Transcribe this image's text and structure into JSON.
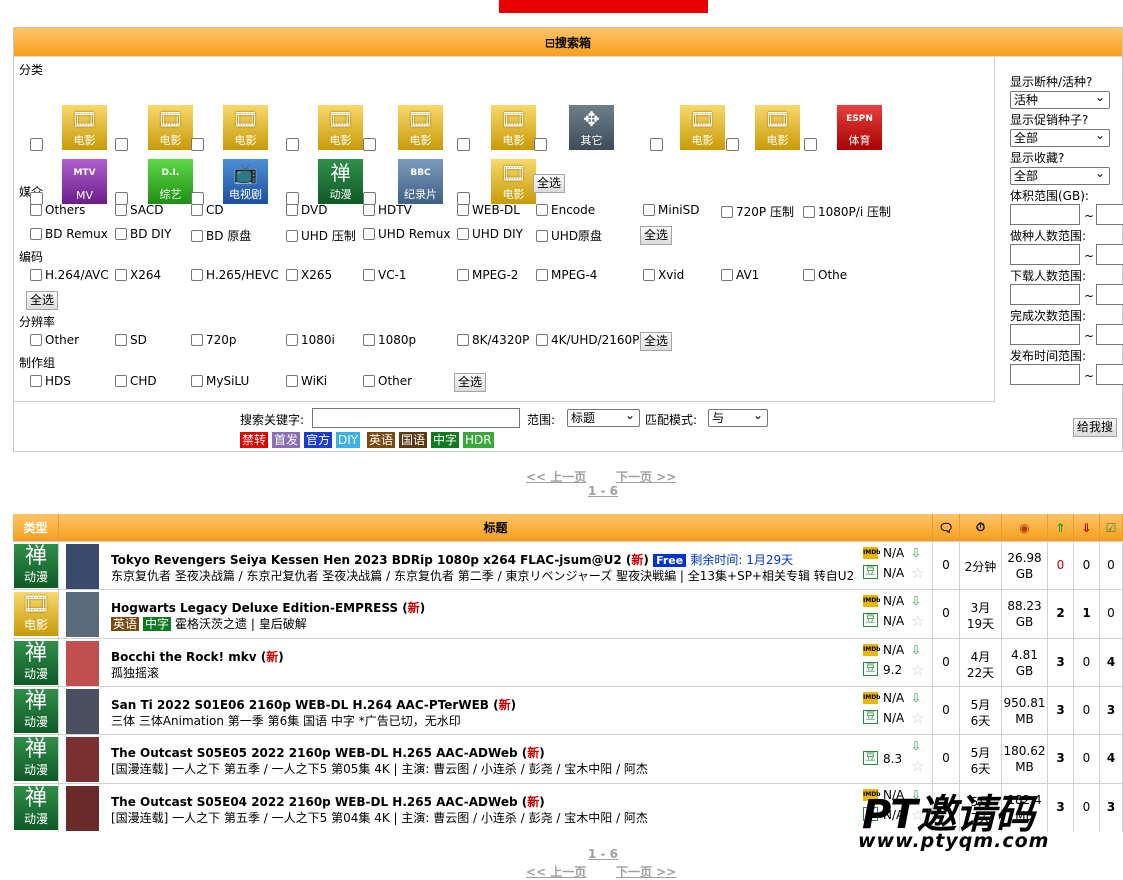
{
  "search_box": {
    "title": "⊟搜索箱",
    "section_category": "分类",
    "section_media": "媒介",
    "section_codec": "编码",
    "section_resolution": "分辨率",
    "section_group": "制作组",
    "select_all": "全选",
    "categories": [
      "电影",
      "电影",
      "电影",
      "电影",
      "电影",
      "电影",
      "其它",
      "电影",
      "电影",
      "体育",
      "MV",
      "综艺",
      "电视剧",
      "动漫",
      "纪录片",
      "电影"
    ],
    "category_glyphs": {
      "movie": "🎞",
      "other": "✥",
      "sport": "ESPN",
      "mv": "MTV",
      "variety": "D.I.",
      "tv": "📺",
      "anime": "禅",
      "doc": "BBC"
    },
    "media": [
      "Others",
      "SACD",
      "CD",
      "DVD",
      "HDTV",
      "WEB-DL",
      "Encode",
      "MiniSD",
      "720P 压制",
      "1080P/i 压制",
      "BD Remux",
      "BD DIY",
      "BD 原盘",
      "UHD 压制",
      "UHD Remux",
      "UHD DIY",
      "UHD原盘"
    ],
    "codec": [
      "H.264/AVC",
      "X264",
      "H.265/HEVC",
      "X265",
      "VC-1",
      "MPEG-2",
      "MPEG-4",
      "Xvid",
      "AV1",
      "Othe"
    ],
    "resolution": [
      "Other",
      "SD",
      "720p",
      "1080i",
      "1080p",
      "8K/4320P",
      "4K/UHD/2160P"
    ],
    "group": [
      "HDS",
      "CHD",
      "MySiLU",
      "WiKi",
      "Other"
    ],
    "keyword_label": "搜索关键字:",
    "keyword_value": "",
    "scope_label": "范围:",
    "scope_value": "标题",
    "match_label": "匹配模式:",
    "match_value": "与",
    "tags": [
      {
        "text": "禁转",
        "color": "#e00000"
      },
      {
        "text": "首发",
        "color": "#8a6fb8"
      },
      {
        "text": "官方",
        "color": "#1a3ccf"
      },
      {
        "text": "DIY",
        "color": "#3ab0e8"
      },
      {
        "text": "英语",
        "color": "#7a4a10"
      },
      {
        "text": "国语",
        "color": "#5a3a10"
      },
      {
        "text": "中字",
        "color": "#0f7a20"
      },
      {
        "text": "HDR",
        "color": "#3aa83a"
      }
    ],
    "search_button": "给我搜",
    "right": {
      "dead_label": "显示断种/活种?",
      "dead_value": "活种",
      "promo_label": "显示促销种子?",
      "promo_value": "全部",
      "fav_label": "显示收藏?",
      "fav_value": "全部",
      "size_label": "体积范围(GB):",
      "seeders_label": "做种人数范围:",
      "leechers_label": "下载人数范围:",
      "completed_label": "完成次数范围:",
      "time_label": "发布时间范围:",
      "tilde": "~"
    }
  },
  "pager": {
    "prev": "<< 上一页",
    "next": "下一页 >>",
    "range": "1 - 6"
  },
  "table": {
    "headers": {
      "type": "类型",
      "title": "标题"
    },
    "rows": [
      {
        "type": "动漫",
        "type_class": "anime",
        "title": "Tokyo Revengers Seiya Kessen Hen 2023 BDRip 1080p x264 FLAC-jsum@U2",
        "new": "新",
        "free": "Free",
        "remaining": "剩余时间: 1月29天",
        "sub": "东京复仇者 圣夜决战篇 / 东京卍复仇者 圣夜决战篇 / 东京复仇者 第二季 / 東京リベンジャーズ 聖夜決戦編 | 全13集+SP+相关专辑 转自U2",
        "imdb": "N/A",
        "douban": "N/A",
        "comments": "0",
        "time1": "2分钟",
        "time2": "",
        "size1": "26.98",
        "size2": "GB",
        "seeders": "0",
        "leechers": "0",
        "completed": "0",
        "poster_color": "#3a4a6a"
      },
      {
        "type": "电影",
        "type_class": "movie",
        "title": "Hogwarts Legacy Deluxe Edition-EMPRESS",
        "new": "新",
        "free": "",
        "remaining": "",
        "sub_tags": [
          "英语",
          "中字"
        ],
        "sub": "霍格沃茨之遗 | 皇后破解",
        "imdb": "N/A",
        "douban": "N/A",
        "comments": "0",
        "time1": "3月",
        "time2": "19天",
        "size1": "88.23",
        "size2": "GB",
        "seeders": "2",
        "leechers": "1",
        "completed": "0",
        "poster_color": "#5a6a7a"
      },
      {
        "type": "动漫",
        "type_class": "anime",
        "title": "Bocchi the Rock! mkv",
        "new": "新",
        "free": "",
        "remaining": "",
        "sub": "孤独摇滚",
        "imdb": "N/A",
        "douban": "9.2",
        "comments": "0",
        "time1": "4月",
        "time2": "22天",
        "size1": "4.81",
        "size2": "GB",
        "seeders": "3",
        "leechers": "0",
        "completed": "4",
        "poster_color": "#c05050"
      },
      {
        "type": "动漫",
        "type_class": "anime",
        "title": "San Ti 2022 S01E06 2160p WEB-DL H.264 AAC-PTerWEB",
        "new": "新",
        "free": "",
        "remaining": "",
        "sub": "三体 三体Animation 第一季 第6集 国语 中字 *广告已切，无水印",
        "imdb": "N/A",
        "douban": "N/A",
        "comments": "0",
        "time1": "5月",
        "time2": "6天",
        "size1": "950.81",
        "size2": "MB",
        "seeders": "3",
        "leechers": "0",
        "completed": "3",
        "poster_color": "#4a5060"
      },
      {
        "type": "动漫",
        "type_class": "anime",
        "title": "The Outcast S05E05 2022 2160p WEB-DL H.265 AAC-ADWeb",
        "new": "新",
        "free": "",
        "remaining": "",
        "sub": "[国漫连载] 一人之下 第五季 / 一人之下5 第05集 4K | 主演: 曹云图 / 小连杀 / 彭尧 / 宝木中阳 / 阿杰",
        "imdb": "",
        "douban": "8.3",
        "comments": "0",
        "time1": "5月",
        "time2": "6天",
        "size1": "180.62",
        "size2": "MB",
        "seeders": "3",
        "leechers": "0",
        "completed": "4",
        "poster_color": "#7a3030"
      },
      {
        "type": "动漫",
        "type_class": "anime",
        "title": "The Outcast S05E04 2022 2160p WEB-DL H.265 AAC-ADWeb",
        "new": "新",
        "free": "",
        "remaining": "",
        "sub": "[国漫连载] 一人之下 第五季 / 一人之下5 第04集 4K | 主演: 曹云图 / 小连杀 / 彭尧 / 宝木中阳 / 阿杰",
        "imdb": "N/A",
        "douban": "N/A",
        "comments": "0",
        "time1": "5月",
        "time2": "7天",
        "size1": "182.4",
        "size2": "MB",
        "seeders": "3",
        "leechers": "0",
        "completed": "3",
        "poster_color": "#6a2a2a"
      }
    ]
  },
  "watermark": {
    "brand": "PT邀请码",
    "url": "www.ptyqm.com"
  }
}
